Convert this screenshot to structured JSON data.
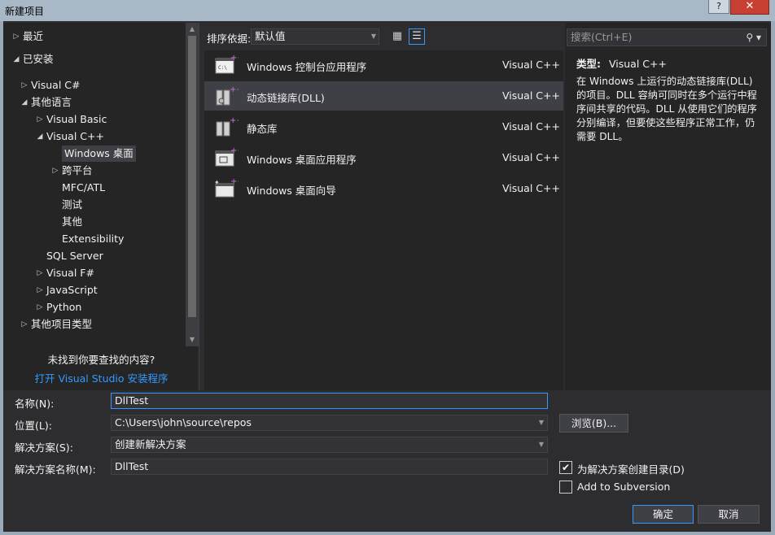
{
  "window": {
    "title": "新建项目",
    "help": "?",
    "close": "✕"
  },
  "tree": {
    "items": [
      {
        "label": "最近",
        "arrow": "▷"
      },
      {
        "label": "已安装",
        "arrow": "◢"
      },
      {
        "label": "Visual C#",
        "arrow": "▷"
      },
      {
        "label": "其他语言",
        "arrow": "◢"
      },
      {
        "label": "Visual Basic",
        "arrow": "▷"
      },
      {
        "label": "Visual C++",
        "arrow": "◢"
      },
      {
        "label": "Windows 桌面",
        "arrow": ""
      },
      {
        "label": "跨平台",
        "arrow": "▷"
      },
      {
        "label": "MFC/ATL",
        "arrow": ""
      },
      {
        "label": "测试",
        "arrow": ""
      },
      {
        "label": "其他",
        "arrow": ""
      },
      {
        "label": "Extensibility",
        "arrow": ""
      },
      {
        "label": "SQL Server",
        "arrow": ""
      },
      {
        "label": "Visual F#",
        "arrow": "▷"
      },
      {
        "label": "JavaScript",
        "arrow": "▷"
      },
      {
        "label": "Python",
        "arrow": "▷"
      },
      {
        "label": "其他项目类型",
        "arrow": "▷"
      }
    ],
    "not_found": "未找到你要查找的内容?",
    "installer_link": "打开 Visual Studio 安装程序"
  },
  "sort": {
    "label": "排序依据:",
    "value": "默认值"
  },
  "templates": [
    {
      "name": "Windows 控制台应用程序",
      "lang": "Visual C++",
      "icon": "console-app-icon"
    },
    {
      "name": "动态链接库(DLL)",
      "lang": "Visual C++",
      "icon": "dll-icon"
    },
    {
      "name": "静态库",
      "lang": "Visual C++",
      "icon": "static-lib-icon"
    },
    {
      "name": "Windows 桌面应用程序",
      "lang": "Visual C++",
      "icon": "desktop-app-icon"
    },
    {
      "name": "Windows 桌面向导",
      "lang": "Visual C++",
      "icon": "desktop-wizard-icon"
    }
  ],
  "details": {
    "search_placeholder": "搜索(Ctrl+E)",
    "type_label": "类型:",
    "type_value": "Visual C++",
    "description": "在 Windows 上运行的动态链接库(DLL)的项目。DLL 容纳可同时在多个运行中程序间共享的代码。DLL 从使用它们的程序分别编译，但要使这些程序正常工作，仍需要 DLL。"
  },
  "form": {
    "name_label": "名称(N):",
    "name_value": "DllTest",
    "location_label": "位置(L):",
    "location_value": "C:\\Users\\john\\source\\repos",
    "browse": "浏览(B)...",
    "solution_label": "解决方案(S):",
    "solution_value": "创建新解决方案",
    "solution_name_label": "解决方案名称(M):",
    "solution_name_value": "DllTest",
    "create_dir": "为解决方案创建目录(D)",
    "create_dir_checked": true,
    "add_svn": "Add to Subversion",
    "add_svn_checked": false,
    "ok": "确定",
    "cancel": "取消"
  },
  "colors": {
    "accent": "#3399ff",
    "background": "#2d2d30",
    "panel": "#252526",
    "selection": "#3f3f46"
  }
}
